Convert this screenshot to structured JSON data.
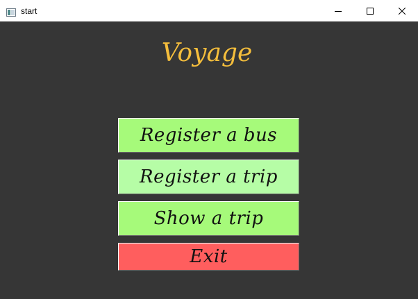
{
  "window": {
    "title": "start",
    "icon": "app-window-icon",
    "controls": {
      "minimize": "minimize-icon",
      "maximize": "maximize-icon",
      "close": "close-icon"
    }
  },
  "main": {
    "heading": "Voyage",
    "buttons": [
      {
        "label": "Register a bus",
        "color": "#a6fa7a"
      },
      {
        "label": "Register a trip",
        "color": "#b6fda6"
      },
      {
        "label": "Show a trip",
        "color": "#a6fa7a"
      },
      {
        "label": "Exit",
        "color": "#ff5e5e"
      }
    ]
  },
  "colors": {
    "background": "#363636",
    "heading": "#f5be3c",
    "titlebar": "#ffffff"
  }
}
